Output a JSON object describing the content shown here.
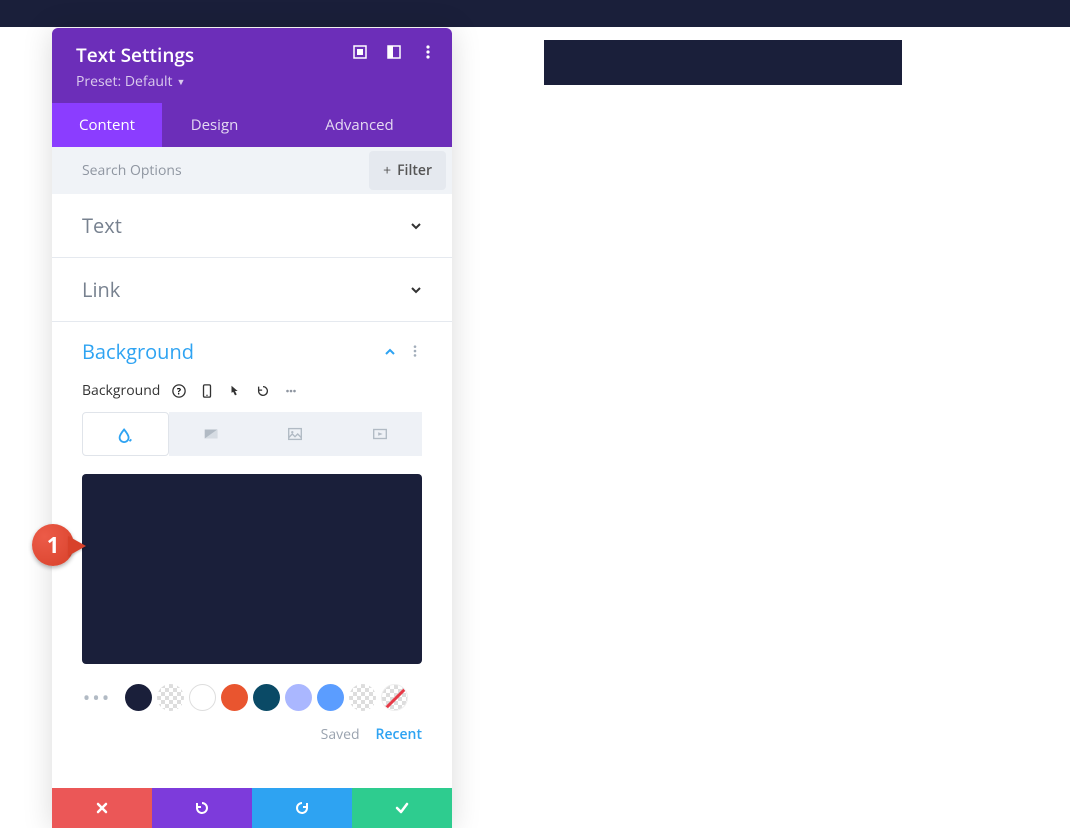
{
  "panel": {
    "title": "Text Settings",
    "preset_label": "Preset: Default"
  },
  "tabs": {
    "content": "Content",
    "design": "Design",
    "advanced": "Advanced"
  },
  "search": {
    "placeholder": "Search Options",
    "filter_label": "Filter"
  },
  "sections": {
    "text": "Text",
    "link": "Link",
    "background": "Background"
  },
  "bg_field_label": "Background",
  "colors": {
    "preview": "#1a1f3a",
    "swatches": [
      "#1a1f3a",
      "checker",
      "#ffffff",
      "#e9552f",
      "#0a4a66",
      "#aab7ff",
      "#5b9dff",
      "checker",
      "slash"
    ]
  },
  "saved_tabs": {
    "saved": "Saved",
    "recent": "Recent"
  },
  "annotation_number": "1"
}
